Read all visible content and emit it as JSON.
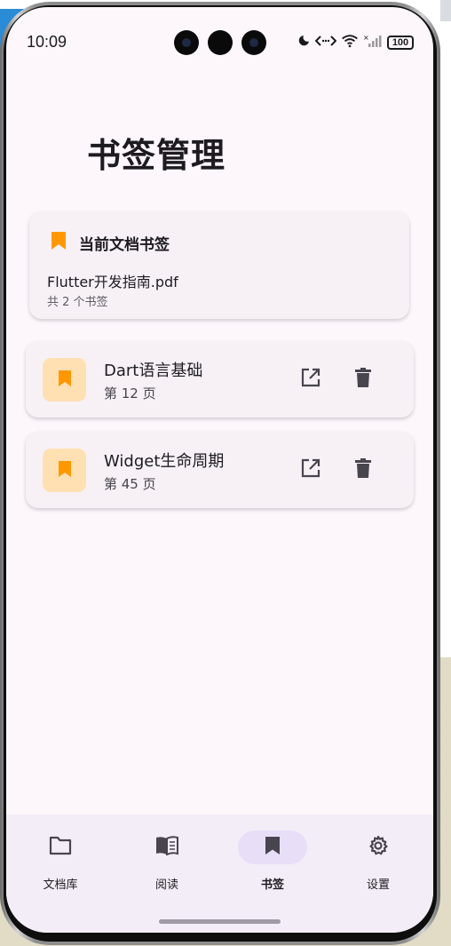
{
  "status_bar": {
    "time": "10:09",
    "battery": "100",
    "icons": [
      "moon-icon",
      "data-arrows-icon",
      "wifi-icon",
      "signal-icon",
      "battery-icon"
    ]
  },
  "page": {
    "title": "书签管理"
  },
  "current_doc": {
    "title": "当前文档书签",
    "file_name": "Flutter开发指南.pdf",
    "count_text": "共 2 个书签",
    "icon": "bookmark-icon"
  },
  "bookmarks": [
    {
      "title": "Dart语言基础",
      "page": "第 12 页"
    },
    {
      "title": "Widget生命周期",
      "page": "第 45 页"
    }
  ],
  "bottom_nav": {
    "items": [
      {
        "label": "文档库",
        "icon": "folder-icon"
      },
      {
        "label": "阅读",
        "icon": "book-icon"
      },
      {
        "label": "书签",
        "icon": "bookmark-icon",
        "active": true
      },
      {
        "label": "设置",
        "icon": "gear-icon"
      }
    ]
  },
  "colors": {
    "background": "#fdf7fc",
    "card": "#f7f1f6",
    "accent_orange": "#ff9800",
    "thumb_bg": "#ffe0b3",
    "nav_bg": "#f3edf7",
    "nav_active": "#e8def8",
    "icon_dark": "#49454f"
  }
}
